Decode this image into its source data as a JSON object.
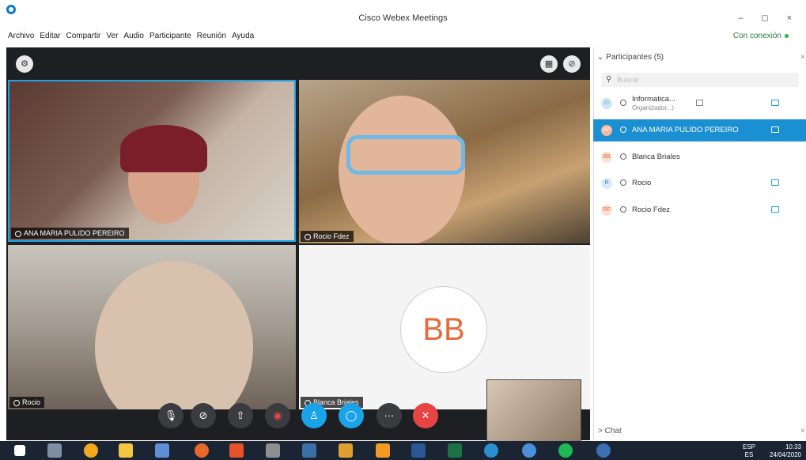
{
  "window": {
    "title": "Cisco Webex Meetings",
    "controls": "– ◻ ×"
  },
  "menu": [
    "Archivo",
    "Editar",
    "Compartir",
    "Ver",
    "Audio",
    "Participante",
    "Reunión",
    "Ayuda"
  ],
  "connection": {
    "label": "Con conexión"
  },
  "video_tiles": [
    {
      "name": "ANA MARIA PULIDO PEREIRO"
    },
    {
      "name": "Rocio Fdez"
    },
    {
      "name": "Rocio"
    },
    {
      "name": "Blanca Briales",
      "initials": "BB"
    }
  ],
  "top_buttons": {
    "settings_icon": "gear-icon",
    "layout_icon": "grid-icon",
    "lock_icon": "lock-icon"
  },
  "toolbar_icons": [
    "mic-off-icon",
    "video-off-icon",
    "share-icon",
    "record-icon",
    "participants-icon",
    "chat-icon",
    "more-icon",
    "end-call-icon"
  ],
  "toolbar_glyphs": {
    "mic": "🎙",
    "video": "⊘",
    "share": "⇧",
    "record": "◉",
    "participants": "♙",
    "chat": "◯",
    "more": "···",
    "end": "✕"
  },
  "panel": {
    "title": "Participantes (5)",
    "search_placeholder": "Buscar",
    "participants": [
      {
        "initials": "",
        "name": "Informatica...",
        "role": "Organizador...)",
        "selected": false
      },
      {
        "initials": "AP",
        "name": "ANA MARIA PULIDO PEREIRO",
        "selected": true
      },
      {
        "initials": "BB",
        "name": "Blanca Briales",
        "selected": false
      },
      {
        "initials": "R",
        "name": "Rocio",
        "selected": false
      },
      {
        "initials": "RF",
        "name": "Rocio Fdez",
        "selected": false
      }
    ],
    "chat_label": "Chat"
  },
  "taskbar": {
    "lang": "ESP\nES",
    "time": "10:33",
    "date": "24/04/2020"
  }
}
